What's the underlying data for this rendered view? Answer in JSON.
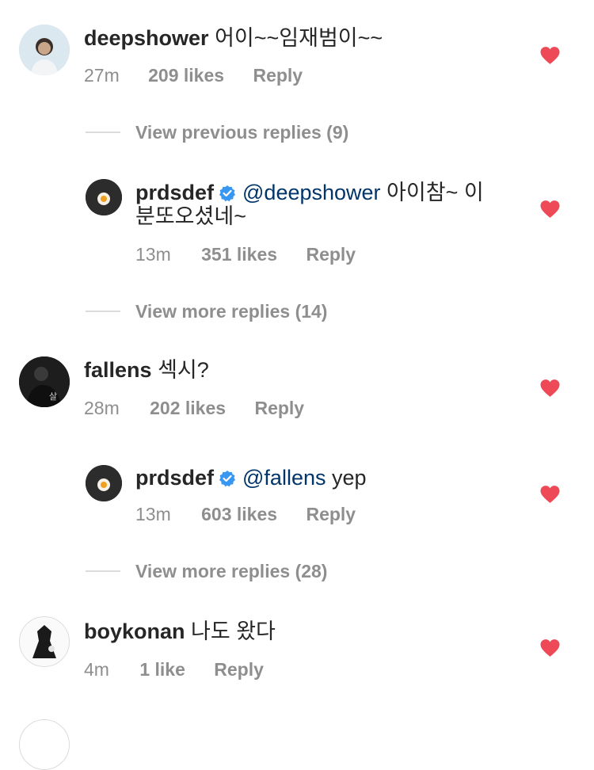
{
  "comments": [
    {
      "username": "deepshower",
      "text": "어이~~임재범이~~",
      "time": "27m",
      "likes": "209 likes",
      "reply_label": "Reply",
      "view_replies": "View previous replies (9)",
      "reply": {
        "username": "prdsdef",
        "mention": "@deepshower",
        "text_line1": "아이참~ 이",
        "text_line2": "분또오셨네~",
        "time": "13m",
        "likes": "351 likes",
        "reply_label": "Reply"
      },
      "view_more": "View more replies (14)"
    },
    {
      "username": "fallens",
      "text": "섹시?",
      "time": "28m",
      "likes": "202 likes",
      "reply_label": "Reply",
      "reply": {
        "username": "prdsdef",
        "mention": "@fallens",
        "text": "yep",
        "time": "13m",
        "likes": "603 likes",
        "reply_label": "Reply"
      },
      "view_more": "View more replies (28)"
    },
    {
      "username": "boykonan",
      "text": "나도 왔다",
      "time": "4m",
      "likes": "1 like",
      "reply_label": "Reply"
    }
  ],
  "colors": {
    "heart": "#ed4956",
    "verified": "#3897f0",
    "mention": "#003569",
    "meta": "#8e8e8e"
  },
  "icons": [
    "heart-icon",
    "verified-badge-icon",
    "avatar"
  ]
}
